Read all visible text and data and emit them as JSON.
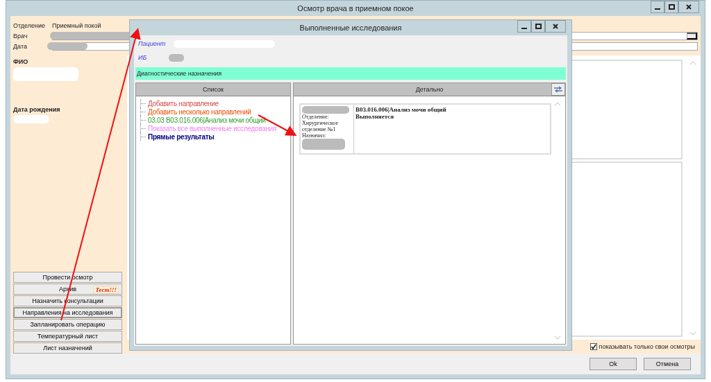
{
  "window": {
    "title": "Осмотр врача в приемном покое"
  },
  "form": {
    "department_label": "Отделение",
    "department_value": "Приемный покой",
    "doctor_label": "Врач",
    "date_label": "Дата",
    "fio_label": "ФИО",
    "birthdate_label": "Дата рождения"
  },
  "action_buttons": [
    {
      "label": "Провести осмотр",
      "selected": false
    },
    {
      "label": "Архив",
      "selected": false
    },
    {
      "label": "Назначить консультации",
      "selected": false
    },
    {
      "label": "Направления на исследования",
      "selected": true
    },
    {
      "label": "Запланировать операцию",
      "selected": false
    },
    {
      "label": "Температурный лист",
      "selected": false
    },
    {
      "label": "Лист назначений",
      "selected": false
    }
  ],
  "test_badge": "Тест!!!",
  "own_only_checkbox": {
    "label": "показывать только свои осмотры",
    "checked": true
  },
  "footer_buttons": [
    "Ok",
    "Отмена"
  ],
  "dialog": {
    "title": "Выполненные исследования",
    "patient_label": "Пациент",
    "ib_label": "ИБ",
    "section_title": "Диагностические назначения",
    "list_header": "Список",
    "detail_header": "Детально",
    "tree": [
      {
        "label": "Добавить направление",
        "kind": "action",
        "color": "#d84848"
      },
      {
        "label": "Добавить несколько направлений",
        "kind": "action",
        "color": "#f04a00"
      },
      {
        "label": "03.03  B03.016.006|Анализ мочи общий",
        "kind": "action",
        "color": "#30a030"
      },
      {
        "label": "Показать все выполненные исследования",
        "kind": "action",
        "color": "#f080f0"
      },
      {
        "label": "Прямые результаты",
        "kind": "group",
        "color": "#000080"
      }
    ],
    "card": {
      "department_label": "Отделение:",
      "department_value": "Хирургическое отделение №1",
      "assigned_label": "Назначил:",
      "test_name": "B03.016.006|Анализ мочи общий",
      "status": "Выполняется"
    }
  }
}
